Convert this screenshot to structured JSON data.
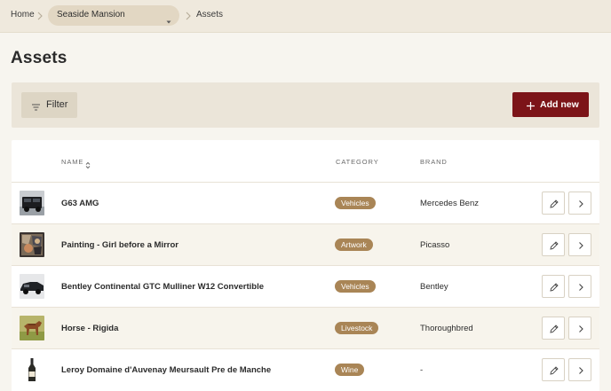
{
  "breadcrumb": {
    "home": "Home",
    "property": "Seaside Mansion",
    "current": "Assets"
  },
  "page": {
    "title": "Assets"
  },
  "toolbar": {
    "filter_label": "Filter",
    "add_label": "Add new"
  },
  "table": {
    "headers": {
      "name": "NAME",
      "category": "CATEGORY",
      "brand": "BRAND"
    },
    "rows": [
      {
        "name": "G63 AMG",
        "category": "Vehicles",
        "brand": "Mercedes Benz",
        "thumbnail": "black-suv"
      },
      {
        "name": "Painting - Girl before a Mirror",
        "category": "Artwork",
        "brand": "Picasso",
        "thumbnail": "cubist-painting"
      },
      {
        "name": "Bentley Continental GTC Mulliner W12 Convertible",
        "category": "Vehicles",
        "brand": "Bentley",
        "thumbnail": "dark-convertible"
      },
      {
        "name": "Horse - Rigida",
        "category": "Livestock",
        "brand": "Thoroughbred",
        "thumbnail": "brown-horse"
      },
      {
        "name": "Leroy Domaine d'Auvenay Meursault Pre de Manche",
        "category": "Wine",
        "brand": "-",
        "thumbnail": "wine-bottle"
      }
    ]
  },
  "icons": {
    "breadcrumb_separator": "chevron-right-icon",
    "property_caret": "caret-down-icon",
    "filter": "filter-lines-icon",
    "add": "plus-icon",
    "sort": "sort-icon",
    "edit": "pencil-icon",
    "open": "chevron-right-icon"
  },
  "colors": {
    "primary": "#7c1418",
    "badge": "#a98556",
    "background": "#f7f5ef",
    "topbar": "#efe9dd"
  }
}
